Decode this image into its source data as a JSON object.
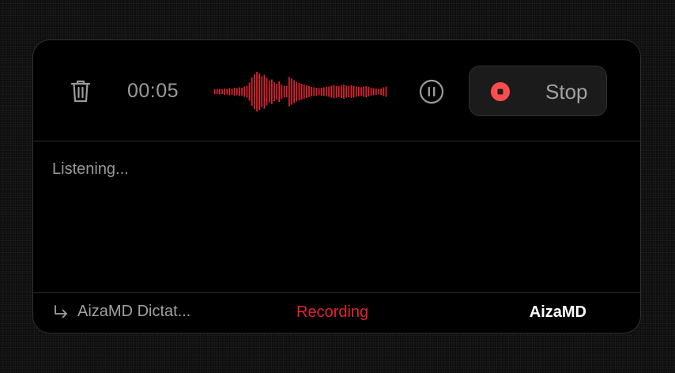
{
  "recorder": {
    "timer": "00:05",
    "stop_label": "Stop",
    "transcript_placeholder": "Listening...",
    "waveform_levels": [
      0.12,
      0.12,
      0.14,
      0.12,
      0.16,
      0.14,
      0.18,
      0.16,
      0.2,
      0.18,
      0.22,
      0.2,
      0.26,
      0.3,
      0.45,
      0.72,
      0.88,
      1.0,
      0.92,
      0.78,
      0.86,
      0.7,
      0.55,
      0.62,
      0.48,
      0.4,
      0.52,
      0.36,
      0.3,
      0.28,
      0.74,
      0.66,
      0.58,
      0.5,
      0.44,
      0.4,
      0.36,
      0.32,
      0.28,
      0.24,
      0.22,
      0.2,
      0.18,
      0.2,
      0.22,
      0.24,
      0.26,
      0.3,
      0.34,
      0.3,
      0.28,
      0.32,
      0.36,
      0.3,
      0.28,
      0.32,
      0.3,
      0.26,
      0.24,
      0.22,
      0.26,
      0.28,
      0.24,
      0.2,
      0.18,
      0.16,
      0.14,
      0.16,
      0.22,
      0.26
    ]
  },
  "footer": {
    "target_app": "AizaMD Dictat...",
    "status": "Recording",
    "brand": "AizaMD"
  },
  "colors": {
    "accent_red": "#e02232",
    "stop_red": "#ff4d4d"
  }
}
